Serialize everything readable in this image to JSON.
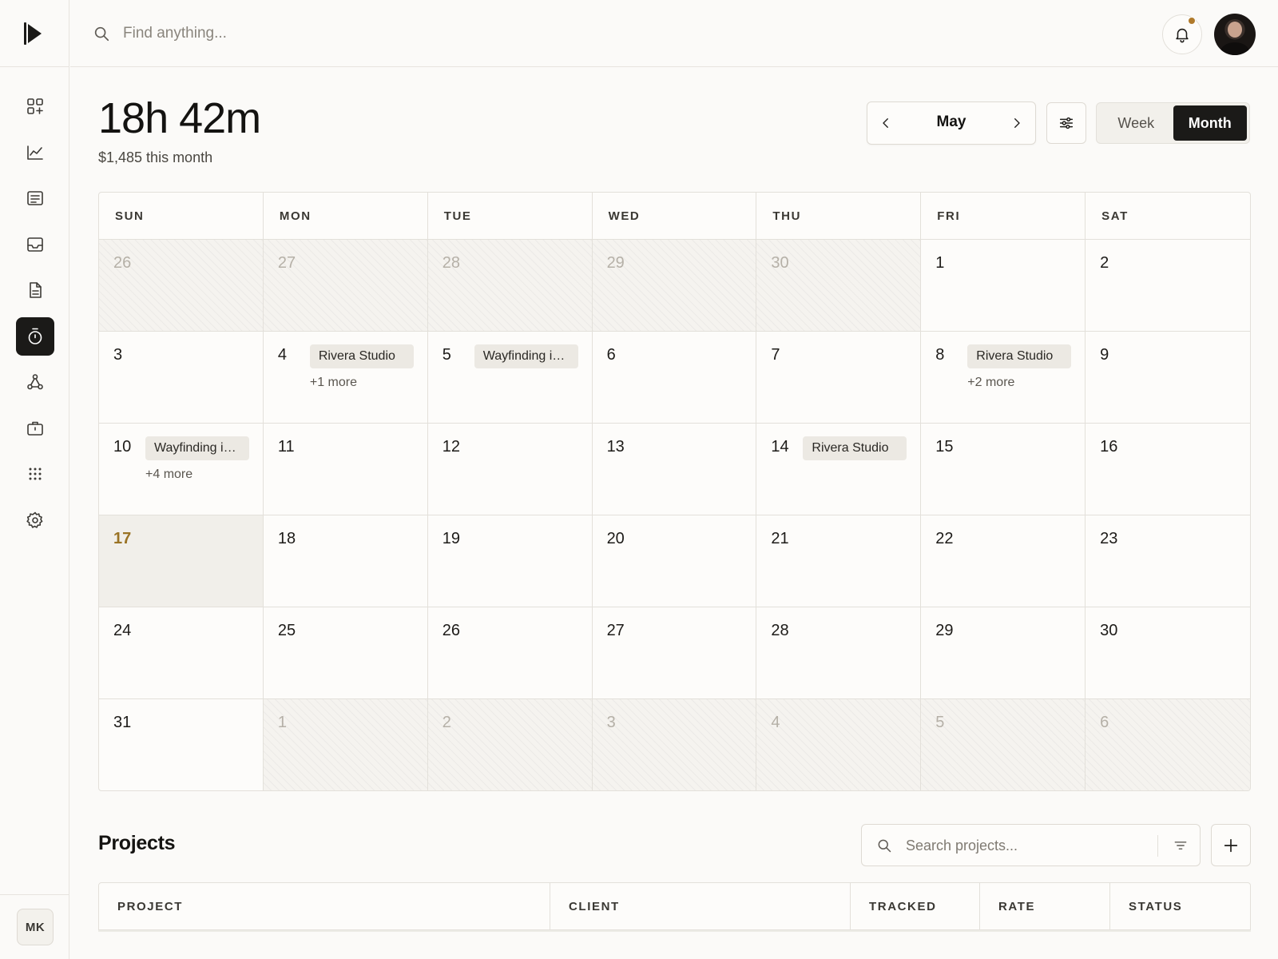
{
  "nav": {
    "items": [
      {
        "name": "dashboard-icon",
        "active": false
      },
      {
        "name": "analytics-icon",
        "active": false
      },
      {
        "name": "list-icon",
        "active": false
      },
      {
        "name": "inbox-icon",
        "active": false
      },
      {
        "name": "document-icon",
        "active": false
      },
      {
        "name": "timer-icon",
        "active": true
      },
      {
        "name": "network-icon",
        "active": false
      },
      {
        "name": "briefcase-icon",
        "active": false
      },
      {
        "name": "apps-grid-icon",
        "active": false
      },
      {
        "name": "settings-icon",
        "active": false
      }
    ],
    "user_initials": "MK"
  },
  "topbar": {
    "search_placeholder": "Find anything...",
    "notification_dot_color": "#b07a2b"
  },
  "header": {
    "total_time": "18h 42m",
    "earnings": "$1,485 this month",
    "month": "May",
    "views": [
      "Week",
      "Month"
    ],
    "selected_view": "Month"
  },
  "calendar": {
    "weekdays": [
      "SUN",
      "MON",
      "TUE",
      "WED",
      "THU",
      "FRI",
      "SAT"
    ],
    "days": [
      {
        "n": "26",
        "outside": true
      },
      {
        "n": "27",
        "outside": true
      },
      {
        "n": "28",
        "outside": true
      },
      {
        "n": "29",
        "outside": true
      },
      {
        "n": "30",
        "outside": true
      },
      {
        "n": "1"
      },
      {
        "n": "2"
      },
      {
        "n": "3"
      },
      {
        "n": "4",
        "event": "Rivera Studio",
        "more": "+1 more"
      },
      {
        "n": "5",
        "event": "Wayfinding identity"
      },
      {
        "n": "6"
      },
      {
        "n": "7"
      },
      {
        "n": "8",
        "event": "Rivera Studio",
        "more": "+2 more"
      },
      {
        "n": "9"
      },
      {
        "n": "10",
        "event": "Wayfinding identity",
        "more": "+4 more"
      },
      {
        "n": "11"
      },
      {
        "n": "12"
      },
      {
        "n": "13"
      },
      {
        "n": "14",
        "event": "Rivera Studio"
      },
      {
        "n": "15"
      },
      {
        "n": "16"
      },
      {
        "n": "17",
        "today": true
      },
      {
        "n": "18"
      },
      {
        "n": "19"
      },
      {
        "n": "20"
      },
      {
        "n": "21"
      },
      {
        "n": "22"
      },
      {
        "n": "23"
      },
      {
        "n": "24"
      },
      {
        "n": "25"
      },
      {
        "n": "26"
      },
      {
        "n": "27"
      },
      {
        "n": "28"
      },
      {
        "n": "29"
      },
      {
        "n": "30"
      },
      {
        "n": "31"
      },
      {
        "n": "1",
        "outside": true
      },
      {
        "n": "2",
        "outside": true
      },
      {
        "n": "3",
        "outside": true
      },
      {
        "n": "4",
        "outside": true
      },
      {
        "n": "5",
        "outside": true
      },
      {
        "n": "6",
        "outside": true
      }
    ]
  },
  "projects": {
    "title": "Projects",
    "search_placeholder": "Search projects...",
    "columns": [
      "PROJECT",
      "CLIENT",
      "TRACKED",
      "RATE",
      "STATUS"
    ]
  }
}
